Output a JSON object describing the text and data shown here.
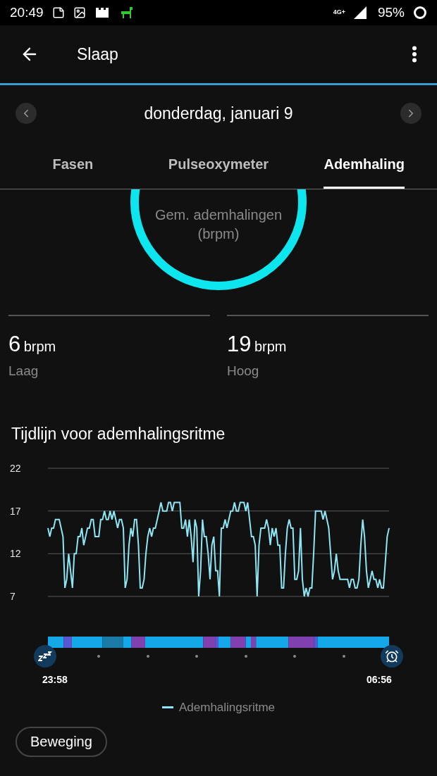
{
  "status_bar": {
    "time": "20:49",
    "network": "4G+",
    "battery": "95%"
  },
  "app_bar": {
    "title": "Slaap"
  },
  "date_nav": {
    "date": "donderdag, januari 9"
  },
  "tabs": [
    {
      "label": "Fasen",
      "selected": false
    },
    {
      "label": "Pulseoxymeter",
      "selected": false
    },
    {
      "label": "Ademhaling",
      "selected": true
    }
  ],
  "average": {
    "label": "Gem. ademhalingen (brpm)"
  },
  "stats": [
    {
      "value": "6",
      "unit": "brpm",
      "label": "Laag"
    },
    {
      "value": "19",
      "unit": "brpm",
      "label": "Hoog"
    }
  ],
  "timeline": {
    "title": "Tijdlijn voor ademhalingsritme",
    "chart_data": {
      "type": "line",
      "ylim": [
        7,
        22
      ],
      "yticks": [
        7,
        12,
        17,
        22
      ],
      "series": [
        {
          "name": "Ademhalingsritme",
          "color": "#8ee6f5",
          "values": [
            15,
            14,
            15,
            15,
            16,
            16,
            16,
            15,
            14,
            8,
            9,
            12,
            10,
            8,
            12,
            12,
            14,
            14,
            15,
            13,
            14,
            15,
            15,
            16,
            16,
            14,
            14,
            14,
            16,
            16,
            17,
            16,
            16,
            17,
            16,
            17,
            16,
            15,
            16,
            16,
            15,
            8,
            9,
            13,
            15,
            14,
            16,
            16,
            13,
            8,
            8,
            9,
            12,
            14,
            15,
            14,
            15,
            15,
            16,
            17,
            18,
            17,
            17,
            17,
            18,
            18,
            17,
            18,
            18,
            18,
            18,
            15,
            15,
            16,
            14,
            16,
            14,
            11,
            16,
            15,
            7,
            10,
            16,
            14,
            14,
            12,
            9,
            13,
            14,
            10,
            10,
            7,
            15,
            15,
            16,
            15,
            16,
            17,
            17,
            18,
            17,
            17,
            18,
            18,
            18,
            17,
            18,
            16,
            14,
            14,
            13,
            7,
            13,
            15,
            15,
            15,
            16,
            15,
            13,
            15,
            14,
            15,
            13,
            13,
            8,
            8,
            12,
            15,
            16,
            15,
            15,
            9,
            9,
            10,
            15,
            9,
            7,
            8,
            7,
            8,
            8,
            12,
            17,
            17,
            17,
            17,
            16,
            17,
            16,
            15,
            12,
            9,
            10,
            12,
            10,
            9,
            9,
            9,
            9,
            9,
            8,
            9,
            9,
            8,
            8,
            9,
            13,
            16,
            14,
            10,
            8,
            9,
            10,
            9,
            9,
            8,
            9,
            8,
            8,
            11,
            14,
            15
          ]
        }
      ]
    },
    "start_time": "23:58",
    "end_time": "06:56"
  },
  "filter_button": {
    "label": "Beweging"
  }
}
